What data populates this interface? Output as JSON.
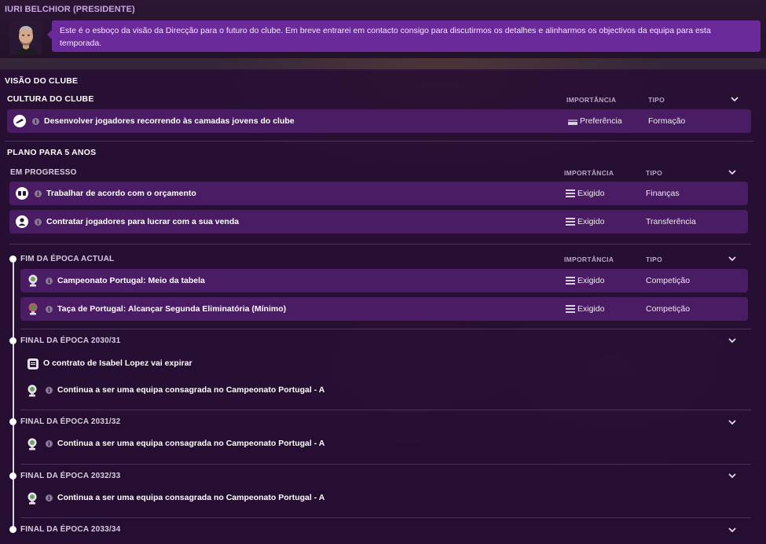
{
  "header": {
    "name": "IURI BELCHIOR (PRESIDENTE)",
    "message": "Este é o esboço da visão da Direcção para o futuro do clube. Em breve entrarei em contacto consigo para discutirmos os detalhes e alinharmos os objectivos da equipa para esta temporada."
  },
  "vision": {
    "title": "VISÃO DO CLUBE",
    "culture": {
      "title": "CULTURA DO CLUBE",
      "col_importance": "IMPORTÂNCIA",
      "col_type": "TIPO",
      "items": [
        {
          "text": "Desenvolver jogadores recorrendo às camadas jovens do clube",
          "importance": "Preferência",
          "type": "Formação",
          "icon": "youth-boot-icon"
        }
      ]
    },
    "plan": {
      "title": "PLANO PARA 5 ANOS",
      "in_progress": {
        "title": "EM PROGRESSO",
        "col_importance": "IMPORTÂNCIA",
        "col_type": "TIPO",
        "items": [
          {
            "text": "Trabalhar de acordo com o orçamento",
            "importance": "Exigido",
            "type": "Finanças",
            "icon": "money-icon"
          },
          {
            "text": "Contratar jogadores para lucrar com a sua venda",
            "importance": "Exigido",
            "type": "Transferência",
            "icon": "person-icon"
          }
        ]
      },
      "end_current": {
        "title": "FIM DA ÉPOCA ACTUAL",
        "col_importance": "IMPORTÂNCIA",
        "col_type": "TIPO",
        "items": [
          {
            "text": "Campeonato Portugal: Meio da tabela",
            "importance": "Exigido",
            "type": "Competição",
            "icon": "league-trophy-icon"
          },
          {
            "text": "Taça de Portugal: Alcançar Segunda Eliminatória (Mínimo)",
            "importance": "Exigido",
            "type": "Competição",
            "icon": "cup-trophy-icon"
          }
        ]
      },
      "season_2030": {
        "title": "FINAL DA ÉPOCA 2030/31",
        "contract_note": "O contrato de Isabel Lopez vai expirar",
        "goal": "Continua a ser uma equipa consagrada no Campeonato Portugal - A"
      },
      "season_2031": {
        "title": "FINAL DA ÉPOCA 2031/32",
        "goal": "Continua a ser uma equipa consagrada no Campeonato Portugal - A"
      },
      "season_2032": {
        "title": "FINAL DA ÉPOCA 2032/33",
        "goal": "Continua a ser uma equipa consagrada no Campeonato Portugal - A"
      },
      "season_2033": {
        "title": "FINAL DA ÉPOCA 2033/34"
      }
    }
  },
  "colors": {
    "row_bg": "#4a1c63",
    "speech_bg": "#6b2a9b",
    "name_color": "#c9a6e0"
  }
}
